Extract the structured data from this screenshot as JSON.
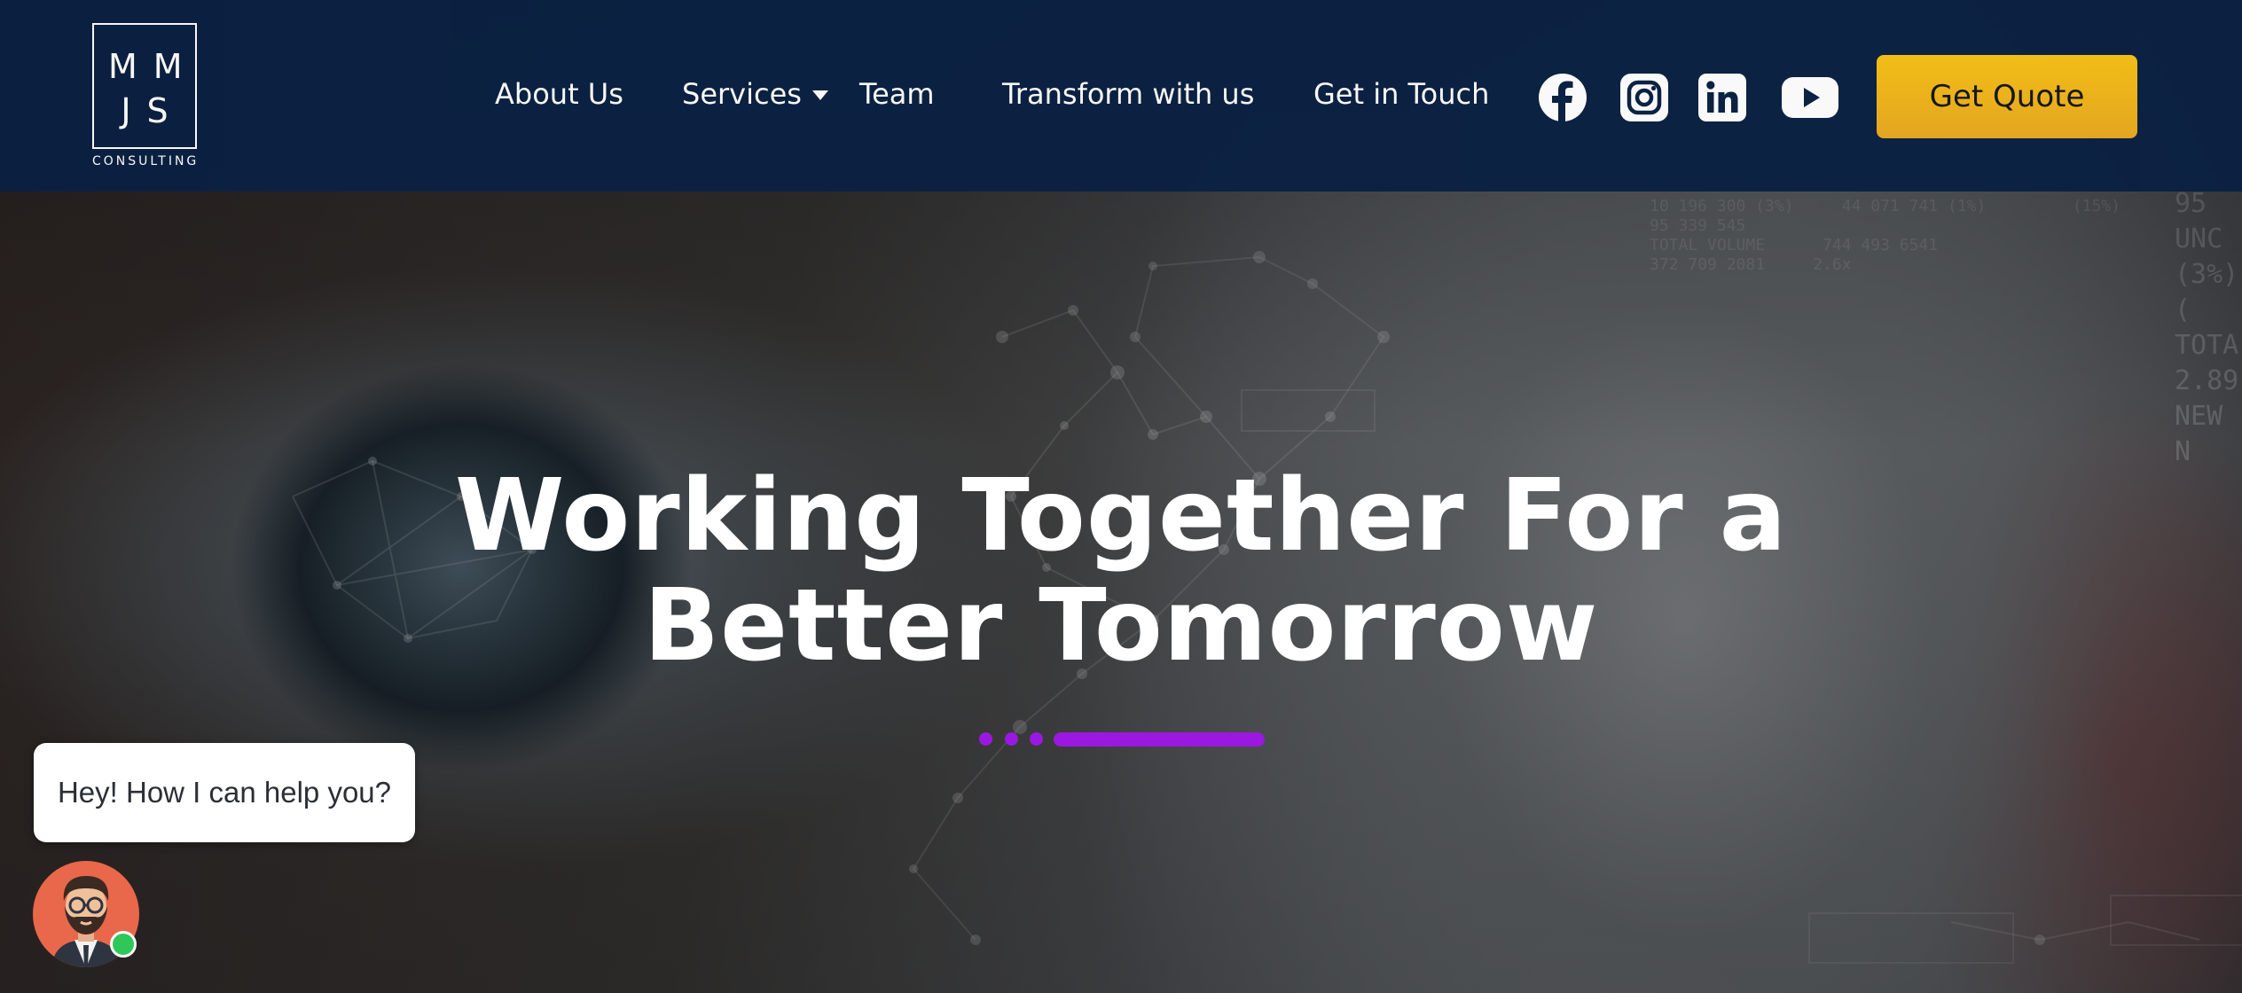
{
  "brand": {
    "logo_line1": "MM",
    "logo_line2": "JS",
    "logo_subtitle": "CONSULTING"
  },
  "nav": {
    "items": [
      {
        "label": "About Us"
      },
      {
        "label": "Services",
        "has_dropdown": true
      },
      {
        "label": "Team"
      },
      {
        "label": "Transform with us"
      },
      {
        "label": "Get in Touch"
      }
    ]
  },
  "social": {
    "icons": [
      "facebook-icon",
      "instagram-icon",
      "linkedin-icon",
      "youtube-icon"
    ]
  },
  "cta": {
    "label": "Get Quote"
  },
  "hero": {
    "title_line1": "Working Together For a",
    "title_line2": "Better Tomorrow"
  },
  "chat": {
    "message": "Hey! How I can help you?",
    "status": "online"
  },
  "colors": {
    "navbar_bg": "#0b2142",
    "cta_bg": "#f5bc1a",
    "accent_purple": "#9b18e0",
    "online_green": "#2fc75a",
    "avatar_bg": "#e9674b"
  }
}
